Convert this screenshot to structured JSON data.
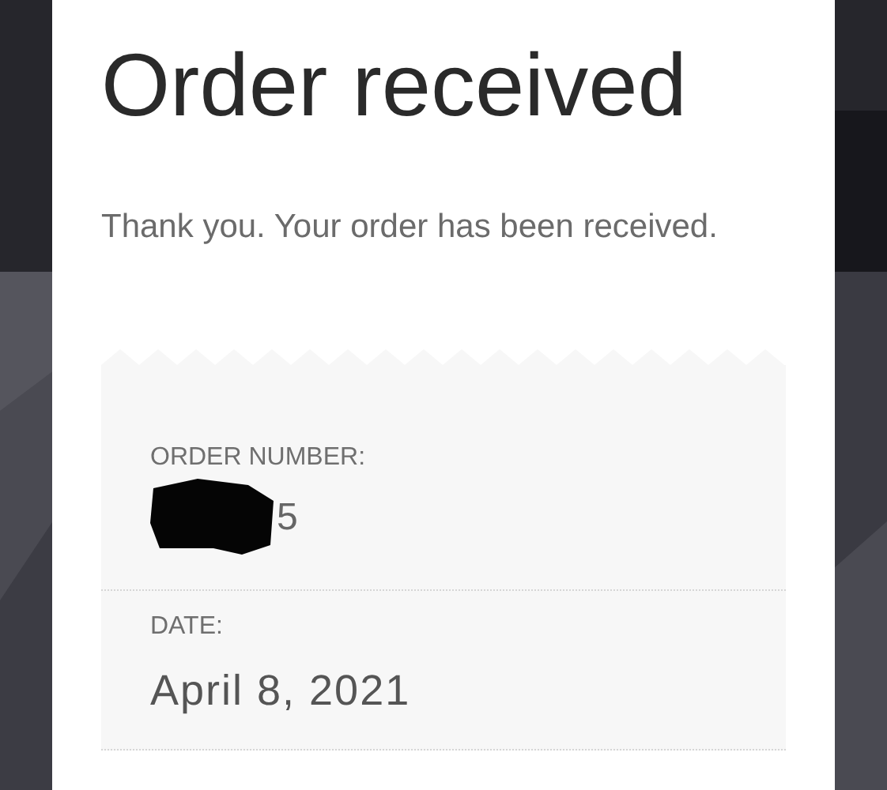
{
  "title": "Order received",
  "message": "Thank you. Your order has been received.",
  "details": [
    {
      "label": "ORDER NUMBER:",
      "value": "5",
      "redacted": true
    },
    {
      "label": "DATE:",
      "value": "April 8, 2021",
      "redacted": false
    }
  ]
}
